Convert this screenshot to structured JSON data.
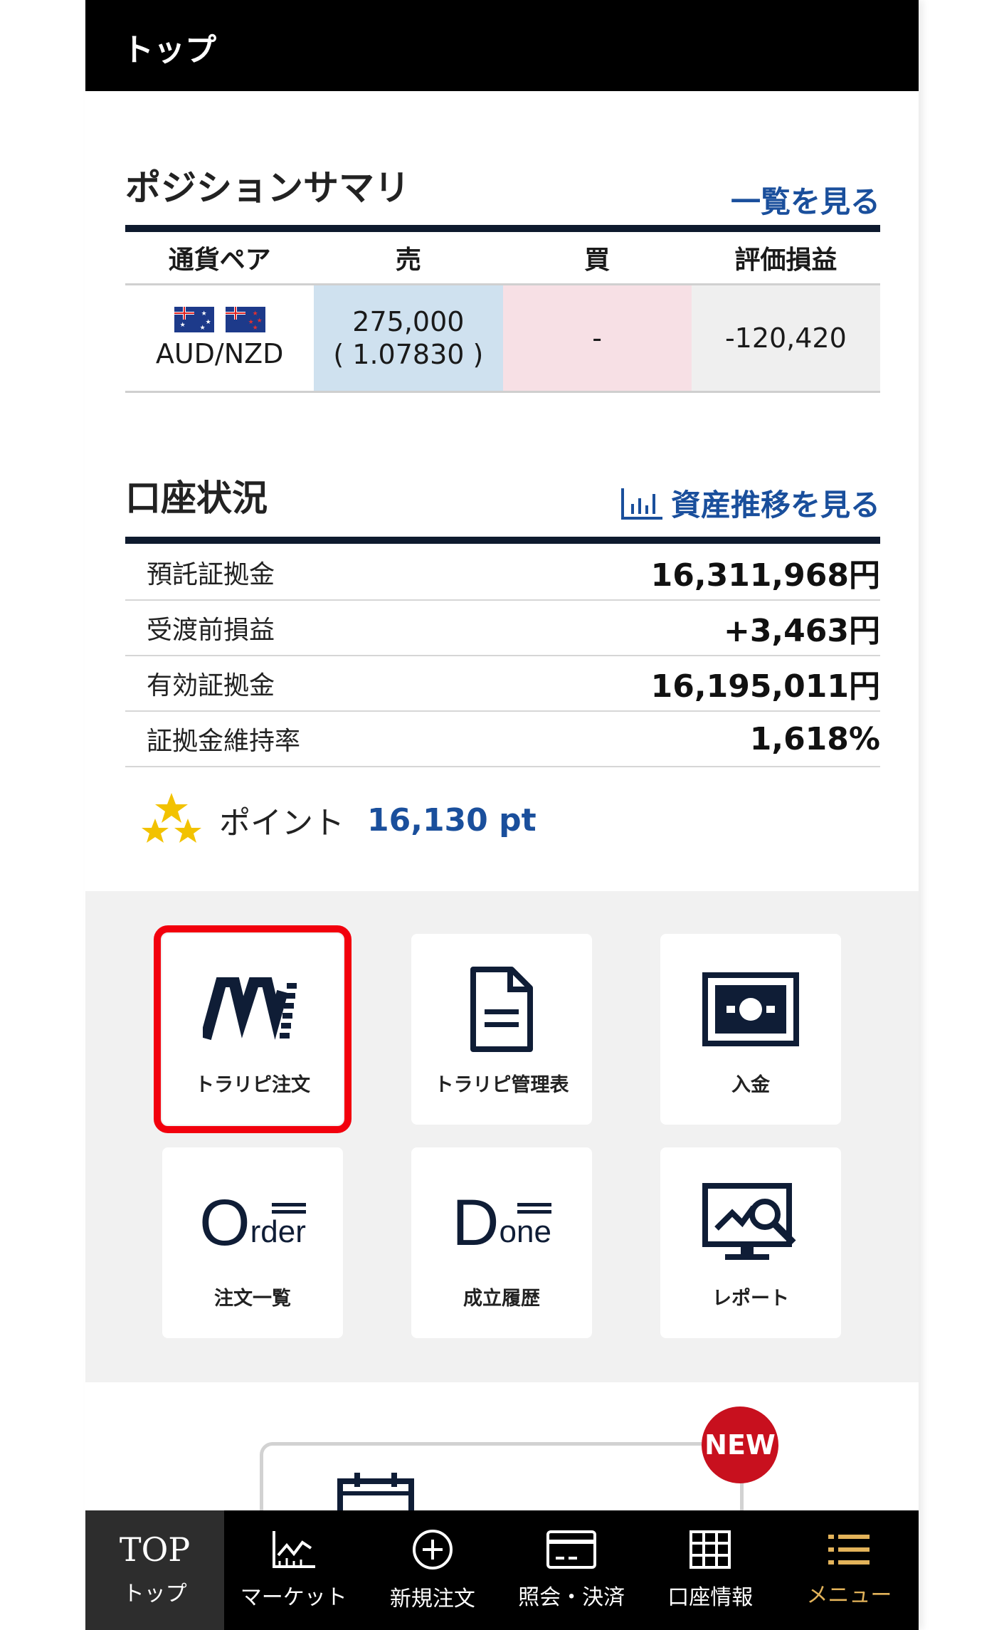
{
  "header": {
    "title": "トップ"
  },
  "position_summary": {
    "title": "ポジションサマリ",
    "link": "一覧を見る",
    "columns": [
      "通貨ペア",
      "売",
      "買",
      "評価損益"
    ],
    "rows": [
      {
        "pair": "AUD/NZD",
        "sell_qty": "275,000",
        "sell_rate": "( 1.07830 )",
        "buy": "-",
        "pl": "-120,420"
      }
    ]
  },
  "account": {
    "title": "口座状況",
    "link": "資産推移を見る",
    "rows": [
      {
        "label": "預託証拠金",
        "value": "16,311,968円"
      },
      {
        "label": "受渡前損益",
        "value": "+3,463円"
      },
      {
        "label": "有効証拠金",
        "value": "16,195,011円"
      },
      {
        "label": "証拠金維持率",
        "value": "1,618%"
      }
    ]
  },
  "points": {
    "label": "ポイント",
    "value": "16,130 pt"
  },
  "tiles": [
    {
      "label": "トラリピ注文",
      "icon": "trap-repeat-logo-icon",
      "order_text": ""
    },
    {
      "label": "トラリピ管理表",
      "icon": "document-icon"
    },
    {
      "label": "入金",
      "icon": "banknote-icon"
    },
    {
      "label": "注文一覧",
      "icon": "order-icon",
      "glyph_big": "O",
      "glyph_small": "rder"
    },
    {
      "label": "成立履歴",
      "icon": "done-icon",
      "glyph_big": "D",
      "glyph_small": "one"
    },
    {
      "label": "レポート",
      "icon": "report-monitor-icon"
    }
  ],
  "badge": {
    "label": "NEW"
  },
  "nav": {
    "items": [
      {
        "top": "TOP",
        "label": "トップ"
      },
      {
        "label": "マーケット"
      },
      {
        "label": "新規注文"
      },
      {
        "label": "照会・決済"
      },
      {
        "label": "口座情報"
      },
      {
        "label": "メニュー"
      }
    ]
  },
  "colors": {
    "accent": "#1a4f9c",
    "header": "#000000",
    "highlight": "#f2000d",
    "menu": "#e3b35a"
  }
}
